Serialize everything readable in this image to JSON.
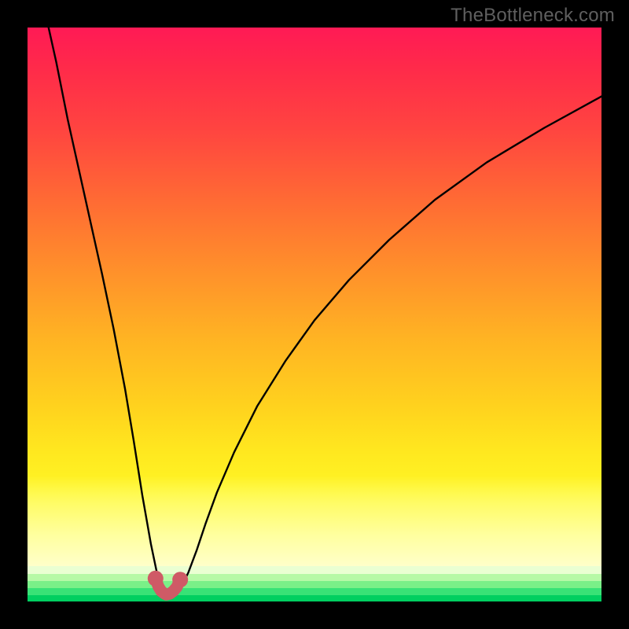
{
  "watermark": "TheBottleneck.com",
  "chart_data": {
    "type": "line",
    "title": "",
    "xlabel": "",
    "ylabel": "",
    "xlim": [
      0,
      100
    ],
    "ylim": [
      0,
      100
    ],
    "series": [
      {
        "name": "curve",
        "x": [
          3,
          5,
          7,
          9,
          11,
          13,
          15,
          17,
          18.5,
          20,
          21.5,
          22.5,
          23.3,
          24,
          24.5,
          25,
          26,
          27,
          28,
          29.5,
          31,
          33,
          36,
          40,
          45,
          50,
          56,
          63,
          71,
          80,
          90,
          100
        ],
        "values": [
          103,
          94,
          84,
          75,
          66,
          57,
          47.5,
          37,
          28,
          18.5,
          10,
          5.2,
          2.4,
          1.4,
          1.2,
          1.4,
          2.0,
          3.0,
          5.0,
          9.0,
          13.5,
          19,
          26,
          34,
          42,
          49,
          56,
          63,
          70,
          76.5,
          82.5,
          88
        ],
        "comment": "y is % from bottom (0) to top (100); the sharp V bottoms at ~x24.5, values near 1 correspond to the green band"
      },
      {
        "name": "marker-segment",
        "x": [
          22.3,
          22.8,
          23.3,
          23.8,
          24.2,
          24.8,
          25.4,
          26.0,
          26.6
        ],
        "values": [
          4.0,
          2.6,
          1.8,
          1.4,
          1.2,
          1.35,
          1.8,
          2.5,
          3.8
        ],
        "comment": "short pink/red thick stroke with round endpoints tracing the bottom of the V"
      }
    ],
    "colors": {
      "curve": "#000000",
      "marker": "#cf5a66",
      "marker_endpoint": "#cf5a66",
      "background_top": "#ff1a55",
      "background_bottom": "#00cf60"
    }
  }
}
